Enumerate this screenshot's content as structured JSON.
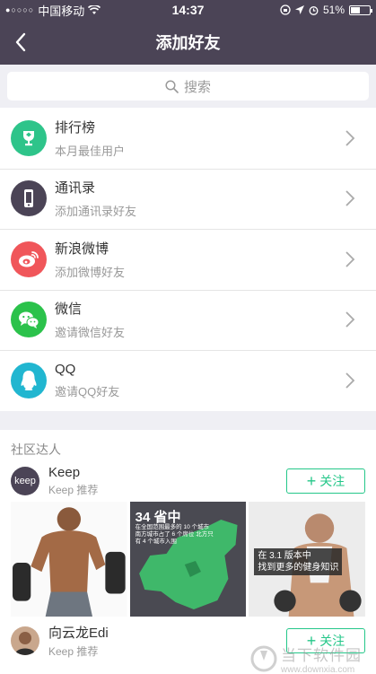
{
  "status_bar": {
    "carrier": "中国移动",
    "time": "14:37",
    "battery": "51%",
    "battery_level": 0.51
  },
  "nav": {
    "title": "添加好友"
  },
  "search": {
    "placeholder": "搜索"
  },
  "list": [
    {
      "icon": "trophy-icon",
      "color": "#2ec48a",
      "label": "排行榜",
      "sub": "本月最佳用户"
    },
    {
      "icon": "phone-icon",
      "color": "#4b4456",
      "label": "通讯录",
      "sub": "添加通讯录好友"
    },
    {
      "icon": "weibo-icon",
      "color": "#f0565a",
      "label": "新浪微博",
      "sub": "添加微博好友"
    },
    {
      "icon": "wechat-icon",
      "color": "#2bc24b",
      "label": "微信",
      "sub": "邀请微信好友"
    },
    {
      "icon": "qq-icon",
      "color": "#21b6d0",
      "label": "QQ",
      "sub": "邀请QQ好友"
    }
  ],
  "community": {
    "title": "社区达人",
    "users": [
      {
        "name": "Keep",
        "tag": "Keep 推荐",
        "avatar_text": "keep",
        "follow": "关注"
      },
      {
        "name": "向云龙Edi",
        "tag": "Keep 推荐",
        "follow": "关注"
      }
    ],
    "photos": {
      "map_title": "34 省中",
      "map_text": "在全国范围最多的 10 个城市 南方城市占了 6 个席位 北方只有 4 个城市入围",
      "caption_line1": "在 3.1 版本中",
      "caption_line2": "找到更多的健身知识"
    }
  },
  "watermark": {
    "title": "当下软件园",
    "url": "www.downxia.com"
  }
}
